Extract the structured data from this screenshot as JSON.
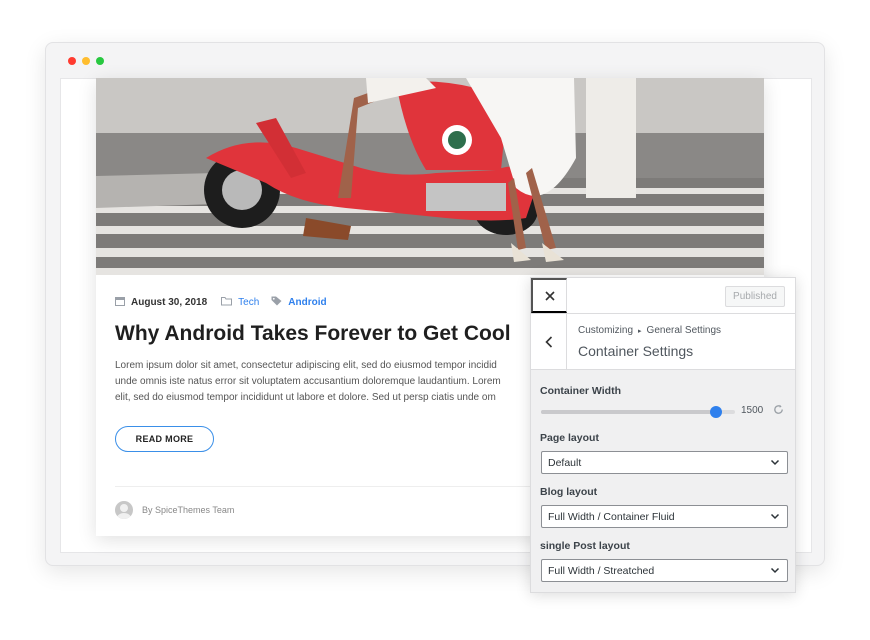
{
  "colors": {
    "accent": "#2f80ed",
    "dot_red": "#ff3b30",
    "dot_yellow": "#ffbd2e",
    "dot_green": "#28c840"
  },
  "post": {
    "hero_image": "street-scooter-photo",
    "date": "August 30, 2018",
    "category": "Tech",
    "tag": "Android",
    "title": "Why Android Takes Forever to Get Cool",
    "excerpt_lines": [
      "Lorem ipsum dolor sit amet, consectetur adipiscing elit, sed do eiusmod tempor incidid",
      "unde omnis iste natus error sit voluptatem accusantium doloremque laudantium. Lorem",
      "elit, sed do eiusmod tempor incididunt ut labore et dolore. Sed ut persp ciatis unde om"
    ],
    "read_more": "READ MORE",
    "author": "By SpiceThemes Team"
  },
  "customizer": {
    "close_icon": "close-icon",
    "publish_label": "Published",
    "back_icon": "chevron-left-icon",
    "breadcrumb": [
      "Customizing",
      "General Settings"
    ],
    "section_title": "Container Settings",
    "container_width": {
      "label": "Container Width",
      "value": "1500",
      "fraction": 0.9
    },
    "page_layout": {
      "label": "Page layout",
      "value": "Default"
    },
    "blog_layout": {
      "label": "Blog layout",
      "value": "Full Width / Container Fluid"
    },
    "single_post_layout": {
      "label": "single Post layout",
      "value": "Full Width / Streatched"
    }
  }
}
